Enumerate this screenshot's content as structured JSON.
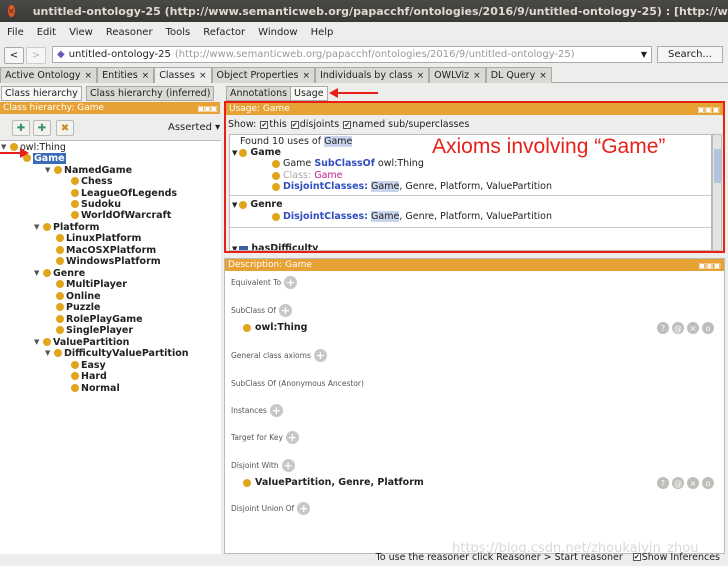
{
  "window": {
    "title": "untitled-ontology-25 (http://www.semanticweb.org/papacchf/ontologies/2016/9/untitled-ontology-25) : [http://www.semanticweb.o"
  },
  "menu": [
    "File",
    "Edit",
    "View",
    "Reasoner",
    "Tools",
    "Refactor",
    "Window",
    "Help"
  ],
  "address": {
    "name": "untitled-ontology-25",
    "uri": "(http://www.semanticweb.org/papacchf/ontologies/2016/9/untitled-ontology-25)",
    "search": "Search..."
  },
  "tabs": [
    "Active Ontology",
    "Entities",
    "Classes",
    "Object Properties",
    "Individuals by class",
    "OWLViz",
    "DL Query"
  ],
  "left": {
    "subtabs": [
      "Class hierarchy",
      "Class hierarchy (inferred)"
    ],
    "header": "Class hierarchy: Game",
    "asserted": "Asserted",
    "tree": [
      "owl:Thing",
      "Game",
      "NamedGame",
      "Chess",
      "LeagueOfLegends",
      "Sudoku",
      "WorldOfWarcraft",
      "Platform",
      "LinuxPlatform",
      "MacOSXPlatform",
      "WindowsPlatform",
      "Genre",
      "MultiPlayer",
      "Online",
      "Puzzle",
      "RolePlayGame",
      "SinglePlayer",
      "ValuePartition",
      "DifficultyValuePartition",
      "Easy",
      "Hard",
      "Normal"
    ]
  },
  "right": {
    "subtabs": [
      "Annotations",
      "Usage"
    ],
    "usage": {
      "header": "Usage: Game",
      "show": "Show:",
      "this": "this",
      "disjoints": "disjoints",
      "named": "named sub/superclasses",
      "found_prefix": "Found 10 uses of",
      "found_term": "Game",
      "g1": "Game",
      "l1a": "Game",
      "l1b": "SubClassOf",
      "l1c": "owl:Thing",
      "l2a": "Class:",
      "l2b": "Game",
      "l3a": "DisjointClasses:",
      "l3b": "Game",
      "l3c": ", Genre, Platform, ValuePartition",
      "g2": "Genre",
      "l4a": "DisjointClasses:",
      "l4b": "Game",
      "l4c": ", Genre, Platform, ValuePartition",
      "g3": "hasDifficulty"
    },
    "annotation": "Axioms involving “Game”",
    "desc": {
      "header": "Description: Game",
      "equiv": "Equivalent To",
      "subclass": "SubClass Of",
      "subclass_val": "owl:Thing",
      "gca": "General class axioms",
      "anc": "SubClass Of (Anonymous Ancestor)",
      "inst": "Instances",
      "key": "Target for Key",
      "disj": "Disjoint With",
      "disj_val": "ValuePartition, Genre, Platform",
      "union": "Disjoint Union Of"
    }
  },
  "status": {
    "text": "To use the reasoner click Reasoner > Start reasoner",
    "show_inferences": "Show Inferences"
  },
  "watermark": "https://blog.csdn.net/zhoukaiyin_zhou"
}
